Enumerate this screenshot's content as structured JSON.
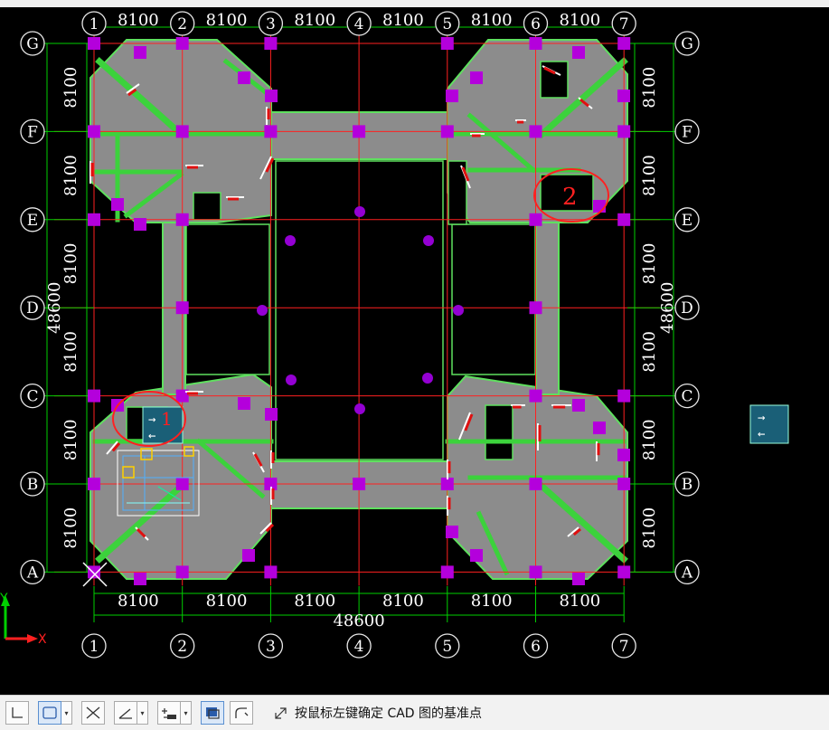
{
  "grid": {
    "columns": [
      "1",
      "2",
      "3",
      "4",
      "5",
      "6",
      "7"
    ],
    "rows": [
      "G",
      "F",
      "E",
      "D",
      "C",
      "B",
      "A"
    ],
    "span_label": "8100",
    "total_label": "48600"
  },
  "markers": {
    "marker1": "1",
    "marker2": "2"
  },
  "axes": {
    "x": "X",
    "y": "Y"
  },
  "toolbar": {
    "buttons": [
      "ortho-toggle",
      "rect-select",
      "cross-select",
      "angle-snap",
      "offset-snap",
      "object-snap",
      "polar-track"
    ]
  },
  "status": {
    "prompt": "按鼠标左键确定 CAD 图的基准点"
  },
  "colors": {
    "background": "#000000",
    "grid_line": "#ff2020",
    "dim_line": "#00ff00",
    "slab": "#8c8c8c",
    "beam": "#3cd23c",
    "column": "#b400dc",
    "annotation": "#e01010"
  }
}
